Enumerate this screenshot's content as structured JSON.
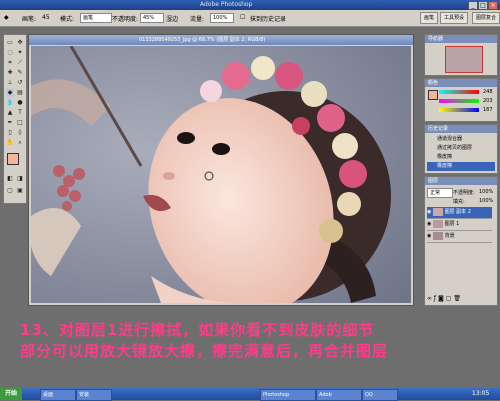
{
  "window": {
    "title": "Adobe Photoshop",
    "min": "_",
    "max": "□",
    "close": "×"
  },
  "options": {
    "brush_label": "画笔:",
    "brush_size": "45",
    "mode_label": "模式:",
    "mode_value": "画笔",
    "opacity_label": "不透明度:",
    "opacity_value": "45%",
    "wet_edges": "湿边",
    "flow_label": "流量:",
    "flow_value": "100%",
    "erase_history": "抹到历史记录",
    "palette_tabs": [
      "画笔",
      "工具预设",
      "图层复合"
    ]
  },
  "document": {
    "title": "0133288549253_jpg @ 66.7% (图层 副本 2, RGB/8)"
  },
  "panels": {
    "navigator_title": "导航器",
    "color_title": "颜色",
    "color_values": {
      "R": "248",
      "G": "203",
      "B": "187"
    },
    "history_title": "历史记录",
    "history_items": [
      "通道混合器",
      "通过拷贝的图层",
      "橡皮擦",
      "橡皮擦"
    ],
    "layers_title": "图层",
    "blend_mode": "正常",
    "opacity_label": "不透明度:",
    "opacity_value": "100%",
    "fill_label": "填充:",
    "fill_value": "100%",
    "layers": [
      {
        "name": "图层 副本 2"
      },
      {
        "name": "图层 1"
      },
      {
        "name": "背景"
      }
    ]
  },
  "caption": {
    "line1": "13、对图层1进行擦拭，如果你看不到皮肤的细节",
    "line2": "部分可以用放大镜放大擦，擦完满意后，再合并图层"
  },
  "taskbar": {
    "start": "开始",
    "tasks": [
      "桌面",
      "安装",
      "Photoshop",
      "Adob",
      "QQ"
    ],
    "clock": "13:05"
  },
  "colors": {
    "caption": "#ff3b8a",
    "foreground_swatch": "#f3b49a",
    "selected_layer": "#3a64b8"
  }
}
